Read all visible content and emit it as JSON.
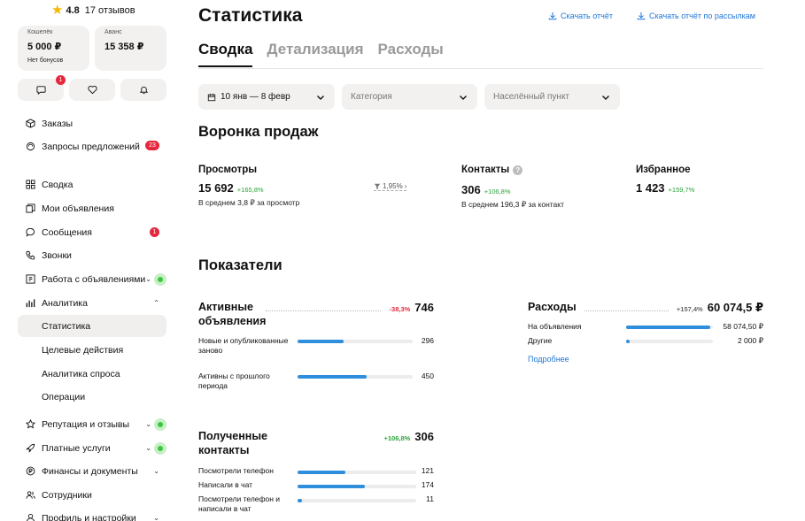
{
  "sidebar": {
    "rating": {
      "score": "4.8",
      "reviews": "17 отзывов"
    },
    "wallet": {
      "label": "Кошелёк",
      "value": "5 000 ₽",
      "sub": "Нет бонусов"
    },
    "advance": {
      "label": "Аванс",
      "value": "15 358 ₽"
    },
    "icon_buttons": [
      {
        "icon": "chat-icon",
        "badge": "1"
      },
      {
        "icon": "heart-icon"
      },
      {
        "icon": "bell-icon"
      }
    ],
    "menu_top": [
      {
        "label": "Заказы",
        "icon": "box-icon"
      },
      {
        "label": "Запросы предложений",
        "icon": "offers-icon",
        "badge": "23"
      }
    ],
    "menu": [
      {
        "label": "Сводка",
        "icon": "grid-icon"
      },
      {
        "label": "Мои объявления",
        "icon": "ads-icon"
      },
      {
        "label": "Сообщения",
        "icon": "chat-icon",
        "badge": "1"
      },
      {
        "label": "Звонки",
        "icon": "phone-icon"
      },
      {
        "label": "Работа с объявлениями",
        "icon": "work-icon"
      },
      {
        "label": "Аналитика",
        "icon": "analytics-icon"
      }
    ],
    "analytics_sub": [
      "Статистика",
      "Целевые действия",
      "Аналитика спроса",
      "Операции"
    ],
    "menu_bottom": [
      {
        "label": "Репутация и отзывы",
        "icon": "star-outline-icon"
      },
      {
        "label": "Платные услуги",
        "icon": "rocket-icon"
      },
      {
        "label": "Финансы и документы",
        "icon": "finance-icon"
      },
      {
        "label": "Сотрудники",
        "icon": "people-icon"
      },
      {
        "label": "Профиль и настройки",
        "icon": "profile-icon"
      }
    ]
  },
  "header": {
    "title": "Статистика",
    "download": "Скачать отчёт",
    "download_mailing": "Скачать отчёт по рассылкам"
  },
  "tabs": [
    "Сводка",
    "Детализация",
    "Расходы"
  ],
  "filters": {
    "date": "10 янв — 8 февр",
    "category": "Категория",
    "city": "Населённый пункт"
  },
  "funnel": {
    "title": "Воронка продаж",
    "views": {
      "label": "Просмотры",
      "value": "15 692",
      "delta": "+165,8%",
      "sub": "В среднем 3,8 ₽ за просмотр"
    },
    "conversion": "1,95%",
    "contacts": {
      "label": "Контакты",
      "value": "306",
      "delta": "+106,8%",
      "sub": "В среднем 196,3 ₽ за контакт"
    },
    "favorites": {
      "label": "Избранное",
      "value": "1 423",
      "delta": "+159,7%"
    }
  },
  "indicators": {
    "title": "Показатели",
    "active": {
      "title": "Активные объявления",
      "delta": "-38,3%",
      "total": "746",
      "rows": [
        {
          "label": "Новые и опубликованные заново",
          "value": "296",
          "fraction": 0.4
        },
        {
          "label": "Активны с прошлого периода",
          "value": "450",
          "fraction": 0.6
        }
      ]
    },
    "expenses": {
      "title": "Расходы",
      "delta": "+157,4%",
      "total": "60 074,5 ₽",
      "rows": [
        {
          "label": "На объявления",
          "value": "58 074,50 ₽",
          "fraction": 0.97
        },
        {
          "label": "Другие",
          "value": "2 000 ₽",
          "fraction": 0.04
        }
      ],
      "more": "Подробнее"
    },
    "contacts": {
      "title": "Полученные контакты",
      "delta": "+106,8%",
      "total": "306",
      "rows": [
        {
          "label": "Посмотрели телефон",
          "value": "121",
          "fraction": 0.4
        },
        {
          "label": "Написали в чат",
          "value": "174",
          "fraction": 0.57
        },
        {
          "label": "Посмотрели телефон и написали в чат",
          "value": "11",
          "fraction": 0.04
        }
      ]
    }
  },
  "colors": {
    "accent": "#1e76d6",
    "bar": "#2f8fdc",
    "positive": "#2aa53a",
    "negative": "#e5283d"
  }
}
